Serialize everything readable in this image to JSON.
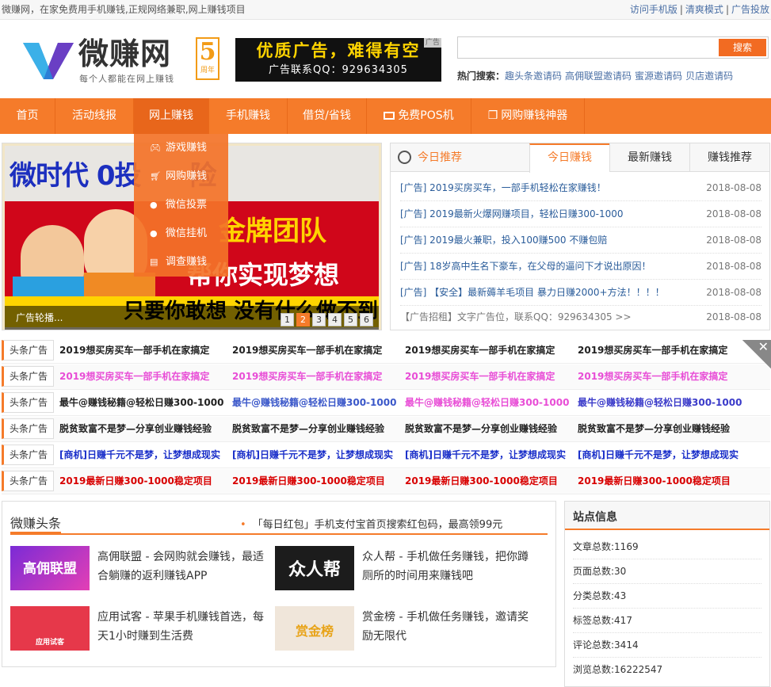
{
  "topbar": {
    "slogan": "微赚网，在家免费用手机赚钱,正规网络兼职,网上赚钱项目",
    "links": [
      "访问手机版",
      "清爽模式",
      "广告投放"
    ]
  },
  "logo": {
    "name": "微赚网",
    "sub": "每个人都能在网上赚钱",
    "anniv_num": "5",
    "anniv_text": "周年"
  },
  "ad_top": {
    "line1": "优质广告，难得有空",
    "line2": "广告联系QQ：929634305",
    "tag": "广告"
  },
  "search": {
    "placeholder": "",
    "button": "搜索"
  },
  "hot": {
    "label": "热门搜索：",
    "keywords": [
      "趣头条邀请码",
      "高佣联盟邀请码",
      "蜜源邀请码",
      "贝店邀请码"
    ]
  },
  "nav": {
    "items": [
      "首页",
      "活动线报",
      "网上赚钱",
      "手机赚钱",
      "借贷/省钱",
      "免费POS机",
      "网购赚钱神器"
    ],
    "dropdown": [
      "游戏赚钱",
      "网购赚钱",
      "微信投票",
      "微信挂机",
      "调查赚钱"
    ]
  },
  "banner": {
    "line1": "微时代 0投",
    "line1b": "险",
    "team": "金牌团队",
    "dream": "帮你实现梦想",
    "dare": "只要你敢想 没有什么做不到",
    "caption": "广告轮播...",
    "pages": [
      "1",
      "2",
      "3",
      "4",
      "5",
      "6"
    ]
  },
  "tabs": {
    "heading": "今日推荐",
    "tabs": [
      "今日赚钱",
      "最新赚钱",
      "赚钱推荐"
    ],
    "rows": [
      {
        "title": "[广告] 2019买房买车，一部手机轻松在家赚钱！",
        "date": "2018-08-08"
      },
      {
        "title": "[广告] 2019最新火爆网赚项目，轻松日赚300-1000",
        "date": "2018-08-08"
      },
      {
        "title": "[广告] 2019最火兼职，投入100赚500 不赚包赔",
        "date": "2018-08-08"
      },
      {
        "title": "[广告] 18岁高中生名下豪车，在父母的逼问下才说出原因！",
        "date": "2018-08-08"
      },
      {
        "title": "[广告] 【安全】最新薅羊毛项目 暴力日赚2000+方法！！！！",
        "date": "2018-08-08"
      },
      {
        "title": "【广告招租】文字广告位，联系QQ：929634305 >>",
        "date": "2018-08-08"
      }
    ]
  },
  "headlines": {
    "label": "头条广告",
    "rows": [
      {
        "text": "2019想买房买车一部手机在家搞定",
        "color": "#222222"
      },
      {
        "text": "2019想买房买车一部手机在家搞定",
        "color": "#e84dd6"
      },
      {
        "text": "最牛@赚钱秘籍@轻松日赚300-1000",
        "color": "#222222"
      },
      {
        "text": "脱贫致富不是梦—分享创业赚钱经验",
        "color": "#222222"
      },
      {
        "text": "[商机]日赚千元不是梦，让梦想成现实",
        "color": "#1a2fc9"
      },
      {
        "text": "2019最新日赚300-1000稳定项目",
        "color": "#d80000"
      }
    ],
    "row3_colors": [
      "#222222",
      "#3a57c9",
      "#e84dd6",
      "#3a3ac9"
    ]
  },
  "news": {
    "title": "微赚头条",
    "marquee": "「每日红包」手机支付宝首页搜索红包码，最高领99元",
    "cards": [
      {
        "thumb": "高佣联盟",
        "text": "高佣联盟 - 会网购就会赚钱，最适合躺赚的返利赚钱APP"
      },
      {
        "thumb": "众人帮",
        "text": "众人帮 - 手机做任务赚钱，把你蹲厕所的时间用来赚钱吧"
      },
      {
        "thumb": "应用试客",
        "text": "应用试客 - 苹果手机赚钱首选，每天1小时赚到生活费"
      },
      {
        "thumb": "赏金榜",
        "text": "赏金榜 - 手机做任务赚钱，邀请奖励无限代"
      }
    ]
  },
  "site": {
    "title": "站点信息",
    "rows": [
      "文章总数:1169",
      "页面总数:30",
      "分类总数:43",
      "标签总数:417",
      "评论总数:3414",
      "浏览总数:16222547"
    ]
  },
  "colors": {
    "accent": "#f57b2a",
    "link": "#2a5c9a"
  }
}
